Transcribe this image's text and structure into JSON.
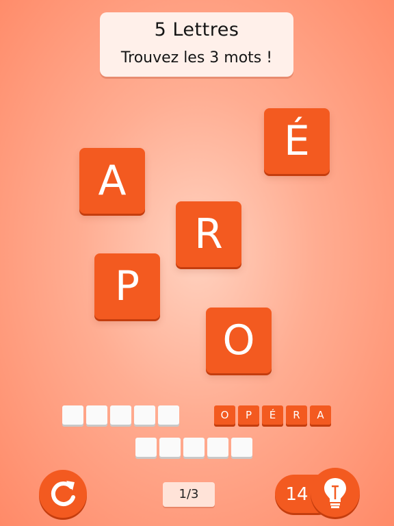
{
  "header": {
    "title": "5 Lettres",
    "subtitle": "Trouvez les 3 mots !"
  },
  "tiles": [
    "A",
    "É",
    "R",
    "P",
    "O"
  ],
  "found_word": [
    "O",
    "P",
    "É",
    "R",
    "A"
  ],
  "progress": "1/3",
  "hints": {
    "count": "14"
  },
  "colors": {
    "tile": "#f35a20",
    "tile_shadow": "#c43d0e",
    "background_center": "#ffd2c0",
    "background_edge": "#ff8a68",
    "header_bg": "#fff0ea"
  },
  "icons": {
    "refresh": "refresh-icon",
    "hint": "lightbulb-icon"
  }
}
